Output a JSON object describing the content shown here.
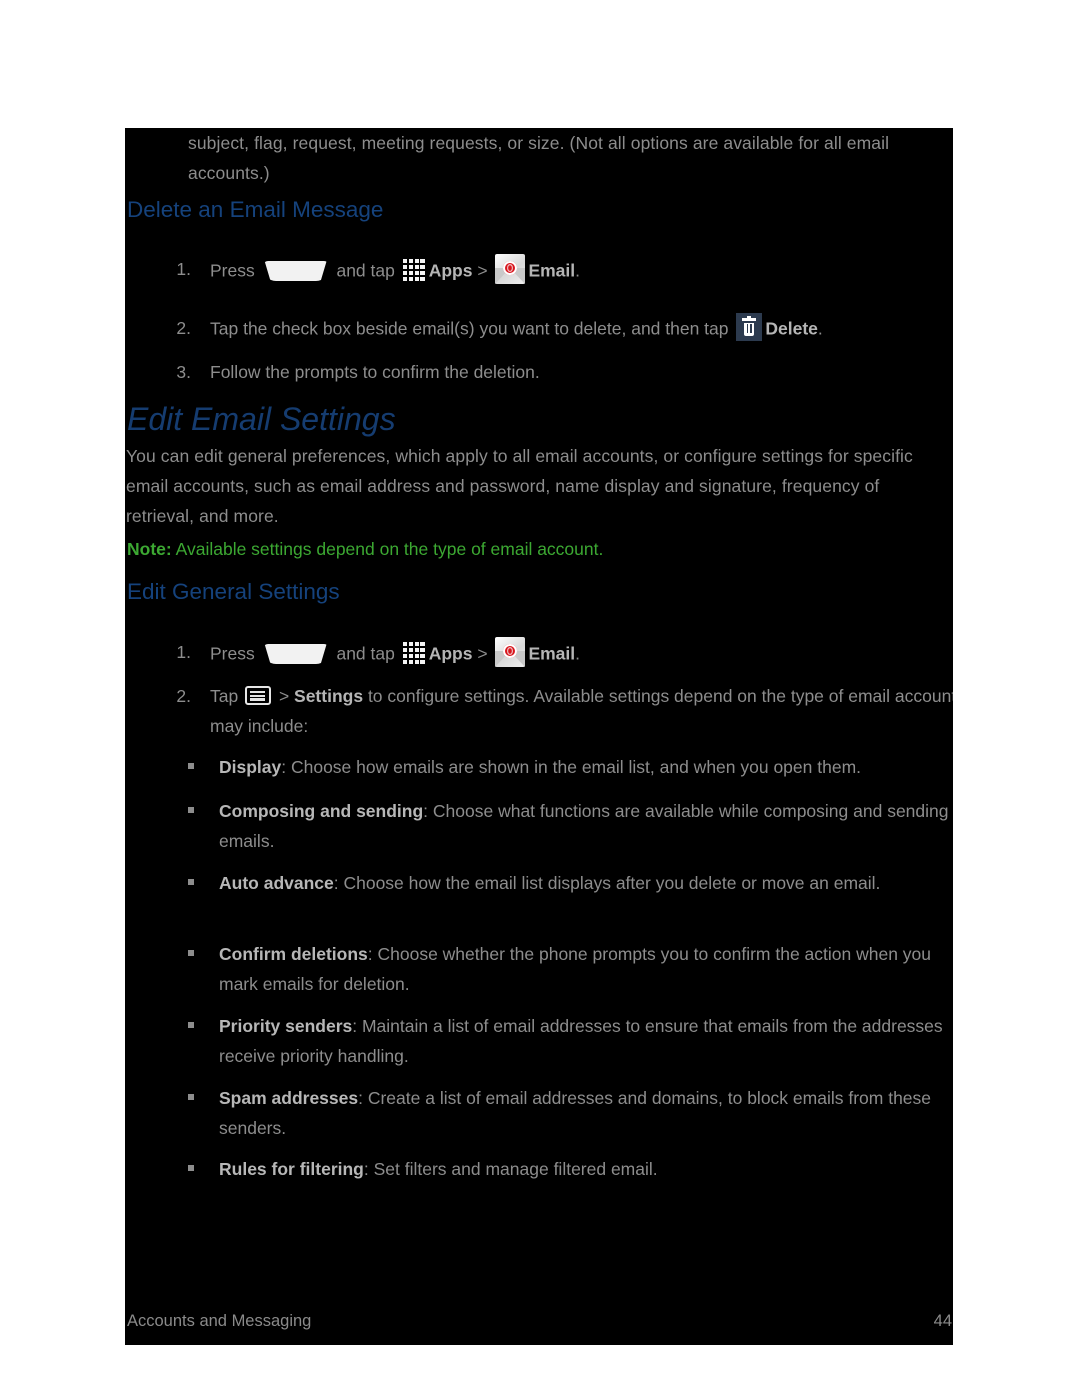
{
  "page": {
    "continuation_paragraph": "subject, flag, request, meeting requests, or size. (Not all options are available for all email accounts.)",
    "footer_left": "Accounts and Messaging",
    "footer_page_number": "44"
  },
  "colors": {
    "page_background": "#000000",
    "body_text": "#8d8d8d",
    "heading_blue": "#153c70",
    "subheading_blue": "#15427c",
    "note_green": "#3ca832",
    "delete_icon_tile": "#2c3a4e",
    "email_badge_red": "#d8151d"
  },
  "sections": [
    {
      "id": "delete-an-email-message",
      "heading": "Delete an Email Message",
      "steps": [
        {
          "number": "1.",
          "parts": [
            {
              "type": "text",
              "text": "Press "
            },
            {
              "type": "icon",
              "icon": "home-key-icon"
            },
            {
              "type": "text",
              "text": " and tap "
            },
            {
              "type": "icon",
              "icon": "apps-grid-icon"
            },
            {
              "type": "bold",
              "text": "Apps"
            },
            {
              "type": "text",
              "text": " > "
            },
            {
              "type": "icon",
              "icon": "email-app-icon"
            },
            {
              "type": "bold",
              "text": "Email"
            },
            {
              "type": "text",
              "text": "."
            }
          ]
        },
        {
          "number": "2.",
          "parts": [
            {
              "type": "text",
              "text": "Tap the check box beside email(s) you want to delete, and then tap "
            },
            {
              "type": "icon",
              "icon": "delete-trash-icon"
            },
            {
              "type": "bold",
              "text": "Delete"
            },
            {
              "type": "text",
              "text": "."
            }
          ]
        },
        {
          "number": "3.",
          "parts": [
            {
              "type": "text",
              "text": "Follow the prompts to confirm the deletion."
            }
          ]
        }
      ]
    },
    {
      "id": "edit-email-settings",
      "title": "Edit Email Settings",
      "intro": "You can edit general preferences, which apply to all email accounts, or configure settings for specific email accounts, such as email address and password, name display and signature, frequency of retrieval, and more.",
      "note": {
        "label": "Note:",
        "text": " Available settings depend on the type of email account."
      },
      "heading": "Edit General Settings",
      "steps": [
        {
          "number": "1.",
          "parts": [
            {
              "type": "text",
              "text": "Press "
            },
            {
              "type": "icon",
              "icon": "home-key-icon"
            },
            {
              "type": "text",
              "text": " and tap "
            },
            {
              "type": "icon",
              "icon": "apps-grid-icon"
            },
            {
              "type": "bold",
              "text": "Apps"
            },
            {
              "type": "text",
              "text": " > "
            },
            {
              "type": "icon",
              "icon": "email-app-icon"
            },
            {
              "type": "bold",
              "text": "Email"
            },
            {
              "type": "text",
              "text": "."
            }
          ]
        },
        {
          "number": "2.",
          "parts": [
            {
              "type": "text",
              "text": "Tap "
            },
            {
              "type": "icon",
              "icon": "menu-key-icon"
            },
            {
              "type": "text",
              "text": " > "
            },
            {
              "type": "bold",
              "text": "Settings"
            },
            {
              "type": "text",
              "text": " to configure settings. Available settings depend on the type of email account, and may include:"
            }
          ]
        }
      ],
      "bullets": [
        {
          "term": "Display",
          "description": ": Choose how emails are shown in the email list, and when you open them."
        },
        {
          "term": "Composing and sending",
          "description": ": Choose what functions are available while composing and sending emails."
        },
        {
          "term": "Auto advance",
          "description": ": Choose how the email list displays after you delete or move an email."
        },
        {
          "term": "Confirm deletions",
          "description": ": Choose whether the phone prompts you to confirm the action when you mark emails for deletion."
        },
        {
          "term": "Priority senders",
          "description": ": Maintain a list of email addresses to ensure that emails from the addresses receive priority handling."
        },
        {
          "term": "Spam addresses",
          "description": ": Create a list of email addresses and domains, to block emails from these senders."
        },
        {
          "term": "Rules for filtering",
          "description": ": Set filters and manage filtered email."
        }
      ]
    }
  ]
}
